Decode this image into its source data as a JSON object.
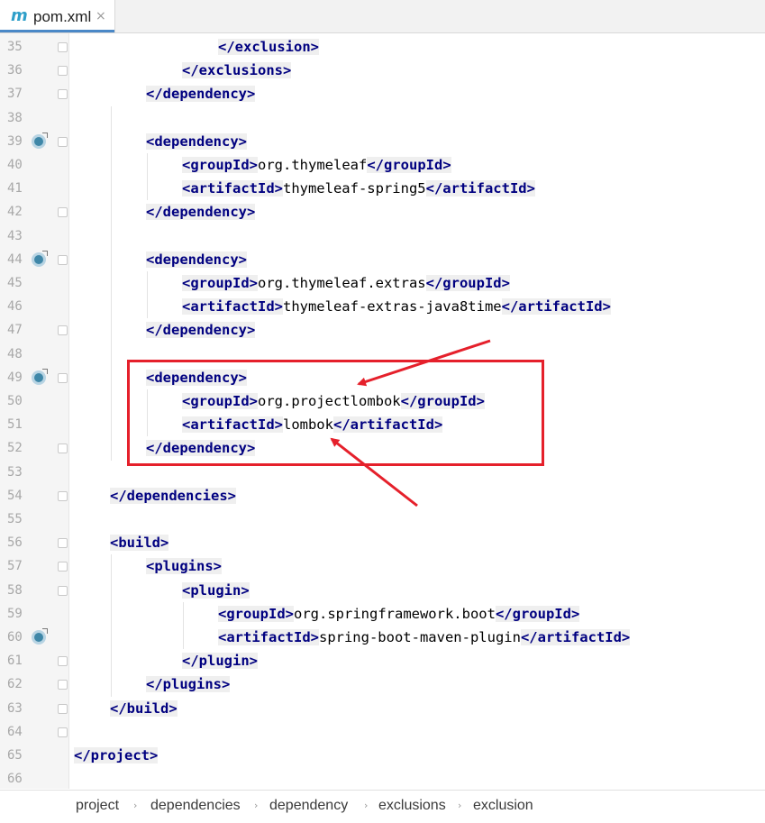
{
  "tab": {
    "label": "pom.xml",
    "icon": "maven-m-icon",
    "icon_glyph": "m",
    "close_glyph": "×"
  },
  "lines": [
    {
      "num": "35",
      "code": [
        {
          "t": "tag",
          "v": "</exclusion>"
        }
      ]
    },
    {
      "num": "36",
      "code": [
        {
          "t": "tag",
          "v": "</exclusions>"
        }
      ]
    },
    {
      "num": "37",
      "code": [
        {
          "t": "tag",
          "v": "</dependency>"
        }
      ]
    },
    {
      "num": "38",
      "code": []
    },
    {
      "num": "39",
      "code": [
        {
          "t": "tag",
          "v": "<dependency>"
        }
      ]
    },
    {
      "num": "40",
      "code": [
        {
          "t": "tag",
          "v": "<groupId>"
        },
        {
          "t": "txt",
          "v": "org.thymeleaf"
        },
        {
          "t": "tag",
          "v": "</groupId>"
        }
      ]
    },
    {
      "num": "41",
      "code": [
        {
          "t": "tag",
          "v": "<artifactId>"
        },
        {
          "t": "txt",
          "v": "thymeleaf-spring5"
        },
        {
          "t": "tag",
          "v": "</artifactId>"
        }
      ]
    },
    {
      "num": "42",
      "code": [
        {
          "t": "tag",
          "v": "</dependency>"
        }
      ]
    },
    {
      "num": "43",
      "code": []
    },
    {
      "num": "44",
      "code": [
        {
          "t": "tag",
          "v": "<dependency>"
        }
      ]
    },
    {
      "num": "45",
      "code": [
        {
          "t": "tag",
          "v": "<groupId>"
        },
        {
          "t": "txt",
          "v": "org.thymeleaf.extras"
        },
        {
          "t": "tag",
          "v": "</groupId>"
        }
      ]
    },
    {
      "num": "46",
      "code": [
        {
          "t": "tag",
          "v": "<artifactId>"
        },
        {
          "t": "txt",
          "v": "thymeleaf-extras-java8time"
        },
        {
          "t": "tag",
          "v": "</artifactId>"
        }
      ]
    },
    {
      "num": "47",
      "code": [
        {
          "t": "tag",
          "v": "</dependency>"
        }
      ]
    },
    {
      "num": "48",
      "code": []
    },
    {
      "num": "49",
      "code": [
        {
          "t": "tag",
          "v": "<dependency>"
        }
      ]
    },
    {
      "num": "50",
      "code": [
        {
          "t": "tag",
          "v": "<groupId>"
        },
        {
          "t": "txt",
          "v": "org.projectlombok"
        },
        {
          "t": "tag",
          "v": "</groupId>"
        }
      ]
    },
    {
      "num": "51",
      "code": [
        {
          "t": "tag",
          "v": "<artifactId>"
        },
        {
          "t": "txt",
          "v": "lombok"
        },
        {
          "t": "tag",
          "v": "</artifactId>"
        }
      ]
    },
    {
      "num": "52",
      "code": [
        {
          "t": "tag",
          "v": "</dependency>"
        }
      ]
    },
    {
      "num": "53",
      "code": []
    },
    {
      "num": "54",
      "code": [
        {
          "t": "tag",
          "v": "</dependencies>"
        }
      ]
    },
    {
      "num": "55",
      "code": []
    },
    {
      "num": "56",
      "code": [
        {
          "t": "tag",
          "v": "<build>"
        }
      ]
    },
    {
      "num": "57",
      "code": [
        {
          "t": "tag",
          "v": "<plugins>"
        }
      ]
    },
    {
      "num": "58",
      "code": [
        {
          "t": "tag",
          "v": "<plugin>"
        }
      ]
    },
    {
      "num": "59",
      "code": [
        {
          "t": "tag",
          "v": "<groupId>"
        },
        {
          "t": "txt",
          "v": "org.springframework.boot"
        },
        {
          "t": "tag",
          "v": "</groupId>"
        }
      ]
    },
    {
      "num": "60",
      "code": [
        {
          "t": "tag",
          "v": "<artifactId>"
        },
        {
          "t": "txt",
          "v": "spring-boot-maven-plugin"
        },
        {
          "t": "tag",
          "v": "</artifactId>"
        }
      ]
    },
    {
      "num": "61",
      "code": [
        {
          "t": "tag",
          "v": "</plugin>"
        }
      ]
    },
    {
      "num": "62",
      "code": [
        {
          "t": "tag",
          "v": "</plugins>"
        }
      ]
    },
    {
      "num": "63",
      "code": [
        {
          "t": "tag",
          "v": "</build>"
        }
      ]
    },
    {
      "num": "64",
      "code": []
    },
    {
      "num": "65",
      "code": [
        {
          "t": "tag",
          "v": "</project>"
        }
      ]
    },
    {
      "num": "66",
      "code": []
    }
  ],
  "gutter_icons": {
    "run_icon": "maven-dependency-run-icon",
    "fold_icon": "fold-marker-icon"
  },
  "breadcrumb": [
    "project",
    "dependencies",
    "dependency",
    "exclusions",
    "exclusion"
  ],
  "breadcrumb_separator": "›",
  "colors": {
    "tag": "#000080",
    "highlight_box": "#e5202b",
    "tab_accent": "#4a88c7"
  }
}
